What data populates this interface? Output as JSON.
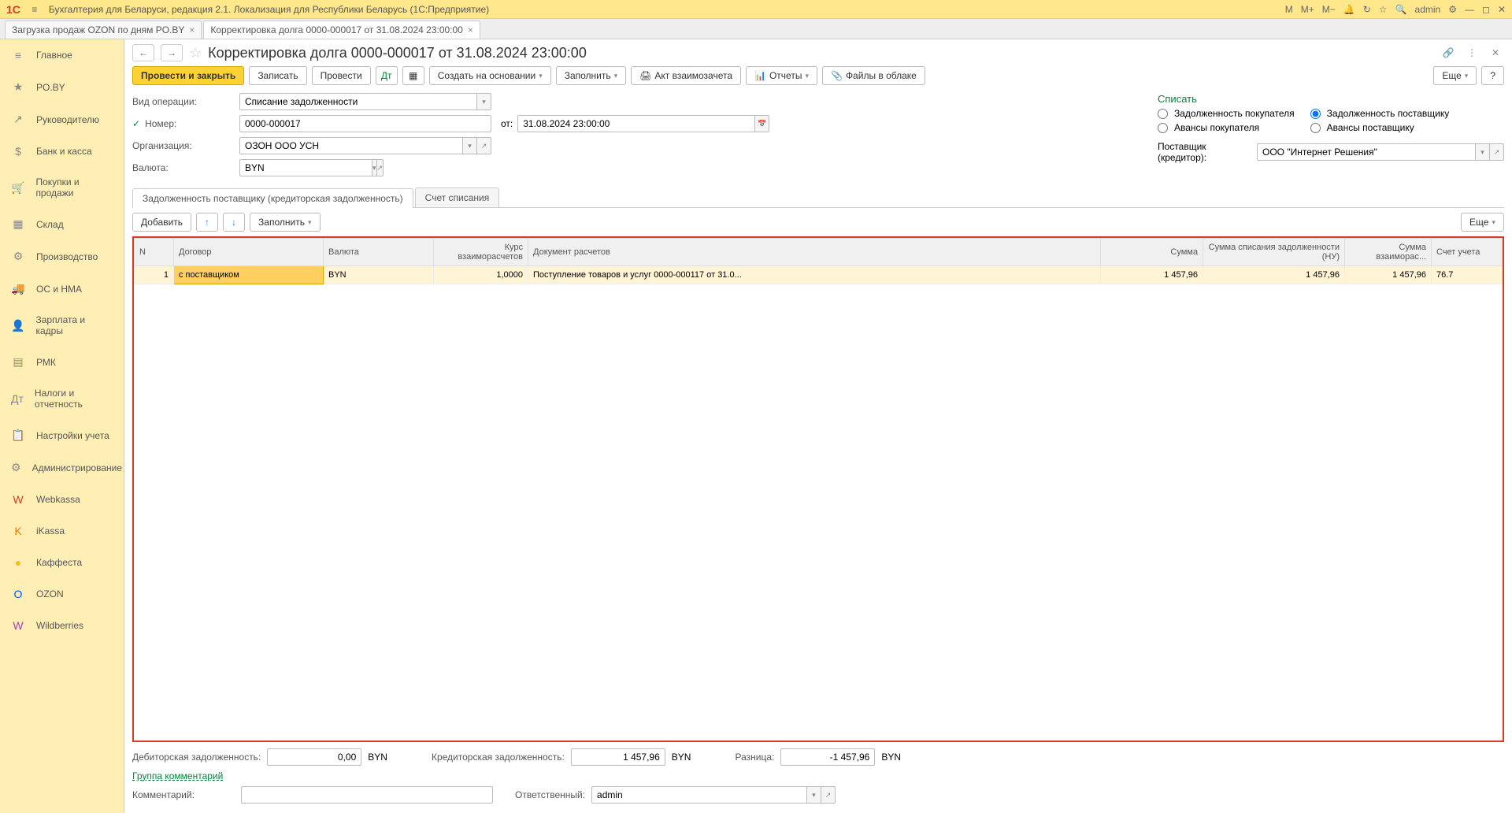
{
  "titlebar": {
    "logo": "1C",
    "title": "Бухгалтерия для Беларуси, редакция 2.1. Локализация для Республики Беларусь   (1С:Предприятие)",
    "right": {
      "m": "M",
      "mplus": "M+",
      "mminus": "M−",
      "user": "admin"
    }
  },
  "tabs": [
    {
      "label": "Загрузка продаж OZON по дням PO.BY"
    },
    {
      "label": "Корректировка долга 0000-000017 от 31.08.2024 23:00:00"
    }
  ],
  "sidebar": [
    {
      "icon": "≡",
      "label": "Главное"
    },
    {
      "icon": "★",
      "label": "PO.BY"
    },
    {
      "icon": "↗",
      "label": "Руководителю"
    },
    {
      "icon": "$",
      "label": "Банк и касса"
    },
    {
      "icon": "🛒",
      "label": "Покупки и продажи"
    },
    {
      "icon": "▦",
      "label": "Склад"
    },
    {
      "icon": "⚙",
      "label": "Производство"
    },
    {
      "icon": "🚚",
      "label": "ОС и НМА"
    },
    {
      "icon": "👤",
      "label": "Зарплата и кадры"
    },
    {
      "icon": "▤",
      "label": "РМК"
    },
    {
      "icon": "Дт",
      "label": "Налоги и отчетность"
    },
    {
      "icon": "📋",
      "label": "Настройки учета"
    },
    {
      "icon": "⚙",
      "label": "Администрирование"
    },
    {
      "icon": "W",
      "label": "Webkassa"
    },
    {
      "icon": "K",
      "label": "iKassa"
    },
    {
      "icon": "●",
      "label": "Каффеста"
    },
    {
      "icon": "O",
      "label": "OZON"
    },
    {
      "icon": "W",
      "label": "Wildberries"
    }
  ],
  "doc": {
    "title": "Корректировка долга 0000-000017 от 31.08.2024 23:00:00",
    "toolbar": {
      "post_close": "Провести и закрыть",
      "write": "Записать",
      "post": "Провести",
      "create_based": "Создать на основании",
      "fill": "Заполнить",
      "act": "Акт взаимозачета",
      "reports": "Отчеты",
      "files": "Файлы в облаке",
      "more": "Еще",
      "help": "?"
    },
    "form": {
      "oper_label": "Вид операции:",
      "oper_value": "Списание задолженности",
      "num_label": "Номер:",
      "num_value": "0000-000017",
      "from_label": "от:",
      "from_value": "31.08.2024 23:00:00",
      "org_label": "Организация:",
      "org_value": "ОЗОН ООО УСН",
      "cur_label": "Валюта:",
      "cur_value": "BYN",
      "writeoff_header": "Списать",
      "r1": "Задолженность покупателя",
      "r2": "Задолженность поставщику",
      "r3": "Авансы покупателя",
      "r4": "Авансы поставщику",
      "supplier_label": "Поставщик (кредитор):",
      "supplier_value": "ООО \"Интернет Решения\""
    },
    "doc_tabs": {
      "t1": "Задолженность поставщику (кредиторская задолженность)",
      "t2": "Счет списания"
    },
    "table_toolbar": {
      "add": "Добавить",
      "fill": "Заполнить",
      "more": "Еще"
    },
    "table": {
      "headers": {
        "n": "N",
        "contract": "Договор",
        "currency": "Валюта",
        "rate": "Курс взаиморасчетов",
        "doc": "Документ расчетов",
        "sum": "Сумма",
        "sum_nu": "Сумма списания задолженности (НУ)",
        "sum_vz": "Сумма взаиморас...",
        "account": "Счет учета"
      },
      "rows": [
        {
          "n": "1",
          "contract": "с поставщиком",
          "currency": "BYN",
          "rate": "1,0000",
          "doc": "Поступление товаров и услуг 0000-000117 от 31.0...",
          "sum": "1 457,96",
          "sum_nu": "1 457,96",
          "sum_vz": "1 457,96",
          "account": "76.7"
        }
      ]
    },
    "footer": {
      "deb_label": "Дебиторская задолженность:",
      "deb_value": "0,00",
      "deb_cur": "BYN",
      "cred_label": "Кредиторская задолженность:",
      "cred_value": "1 457,96",
      "cred_cur": "BYN",
      "diff_label": "Разница:",
      "diff_value": "-1 457,96",
      "diff_cur": "BYN",
      "group_link": "Группа комментарий",
      "comment_label": "Комментарий:",
      "resp_label": "Ответственный:",
      "resp_value": "admin"
    }
  }
}
